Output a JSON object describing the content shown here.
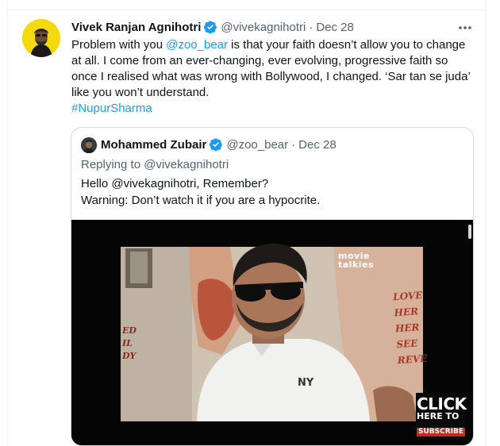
{
  "tweet": {
    "author_name": "Vivek Ranjan Agnihotri",
    "handle": "@vivekagnihotri",
    "separator": "·",
    "date": "Dec 28",
    "text_part1": "Problem with you ",
    "mention": "@zoo_bear",
    "text_part2": " is that your faith doesn’t allow you to change at all. I  come from an ever-changing, ever evolving, progressive faith so once I realised what was wrong with Bollywood, I changed. ‘Sar tan se juda’ like you won’t understand.",
    "hashtag": "#NupurSharma",
    "more_icon": "more-horizontal-icon",
    "verified_icon": "verified-badge-icon"
  },
  "quote": {
    "author_name": "Mohammed Zubair",
    "handle": "@zoo_bear",
    "separator": "·",
    "date": "Dec 28",
    "replying_to": "Replying to @vivekagnihotri",
    "line1": "Hello @vivekagnihotri, Remember?",
    "line2": "Warning: Don’t watch it if you are a hypocrite."
  },
  "video": {
    "watermark_line1": "movie",
    "watermark_line2": "talkies",
    "poster_right": [
      "LOVE",
      "HER",
      "HER",
      "SEE",
      "REVE"
    ],
    "poster_left": [
      "ED",
      "IL",
      "DY"
    ],
    "shirt_text": "NY",
    "click_line1": "CLICK",
    "click_line2": "HERE TO",
    "click_line3": "SUBSCRIBE"
  },
  "colors": {
    "link": "#1d9bf0",
    "muted": "#536471",
    "text": "#0f1419",
    "border": "#cfd9de",
    "avatar_bg": "#f3d90e"
  }
}
